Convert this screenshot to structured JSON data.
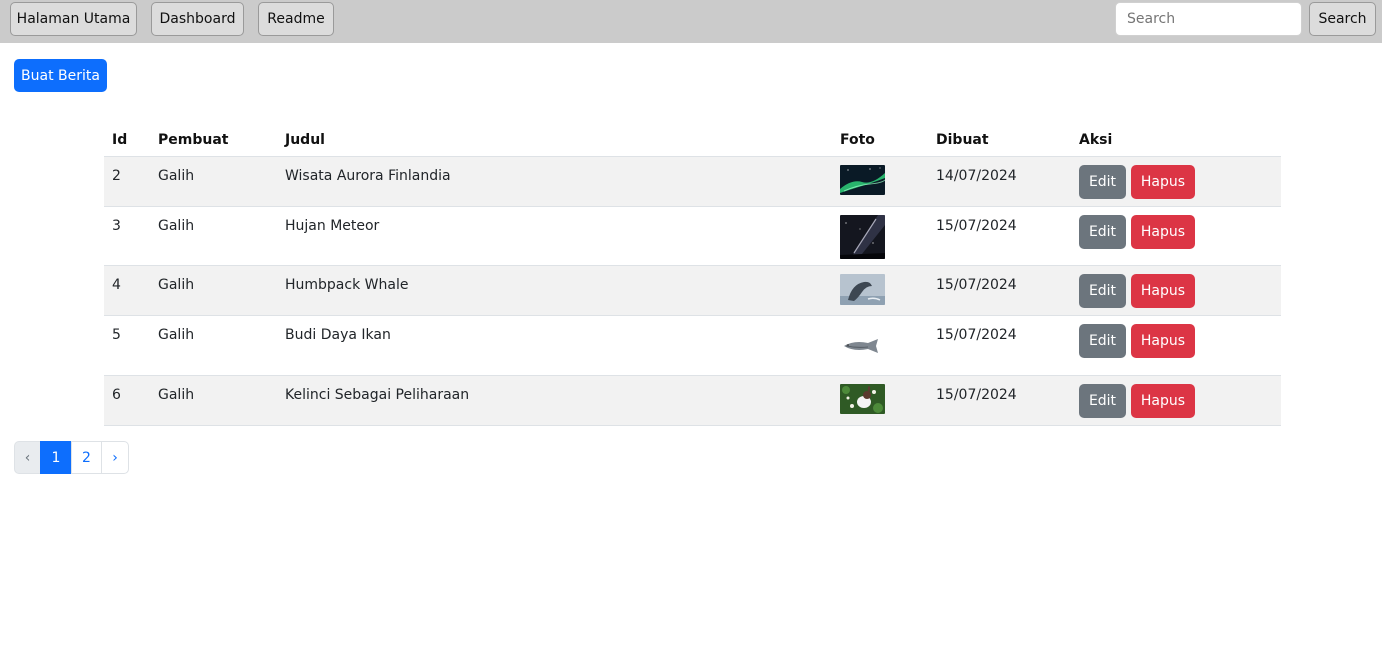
{
  "nav": {
    "items": [
      {
        "label": "Halaman Utama"
      },
      {
        "label": "Dashboard"
      },
      {
        "label": "Readme"
      }
    ],
    "search_placeholder": "Search",
    "search_value": "",
    "search_button": "Search"
  },
  "main": {
    "create_button": "Buat Berita"
  },
  "table": {
    "headers": [
      "Id",
      "Pembuat",
      "Judul",
      "Foto",
      "Dibuat",
      "Aksi"
    ],
    "rows": [
      {
        "id": "2",
        "author": "Galih",
        "title": "Wisata Aurora Finlandia",
        "photo": "aurora-photo",
        "date": "14/07/2024",
        "edit": "Edit",
        "delete": "Hapus"
      },
      {
        "id": "3",
        "author": "Galih",
        "title": "Hujan Meteor",
        "photo": "meteor-photo",
        "date": "15/07/2024",
        "edit": "Edit",
        "delete": "Hapus"
      },
      {
        "id": "4",
        "author": "Galih",
        "title": "Humbpack Whale",
        "photo": "whale-photo",
        "date": "15/07/2024",
        "edit": "Edit",
        "delete": "Hapus"
      },
      {
        "id": "5",
        "author": "Galih",
        "title": "Budi Daya Ikan",
        "photo": "fish-photo",
        "date": "15/07/2024",
        "edit": "Edit",
        "delete": "Hapus"
      },
      {
        "id": "6",
        "author": "Galih",
        "title": "Kelinci Sebagai Peliharaan",
        "photo": "rabbit-photo",
        "date": "15/07/2024",
        "edit": "Edit",
        "delete": "Hapus"
      }
    ]
  },
  "pagination": {
    "prev": "‹",
    "pages": [
      "1",
      "2"
    ],
    "current": "1",
    "next": "›"
  },
  "colors": {
    "primary": "#0d6efd",
    "secondary": "#6c757d",
    "danger": "#dc3545",
    "navbar": "#cbcbcb"
  }
}
